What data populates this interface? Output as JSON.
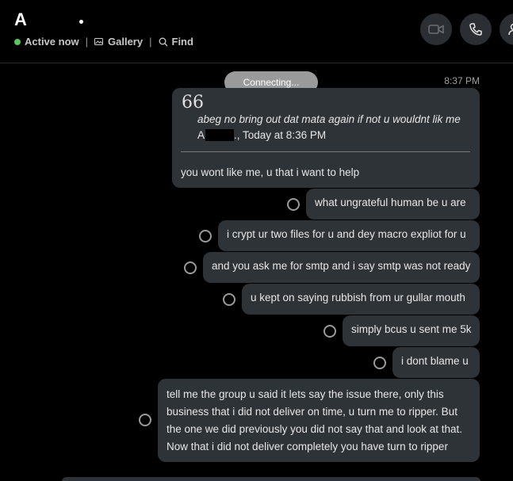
{
  "header": {
    "contact_initial": "A",
    "status_text": "Active now",
    "gallery_label": "Gallery",
    "find_label": "Find",
    "separator": "|"
  },
  "chat": {
    "timestamp": "8:37 PM",
    "connecting_label": "Connecting...",
    "quote": {
      "mark": "66",
      "text": "abeg no bring out dat mata again if not u wouldnt lik me",
      "author_initial": "A",
      "meta_suffix": "., Today at 8:36 PM",
      "reply": "you wont like me, u that i want to help"
    },
    "messages": [
      {
        "text": "what ungrateful human be u are"
      },
      {
        "text": "i crypt ur two files for u and dey macro expliot for u"
      },
      {
        "text": "and you ask me for smtp and i say smtp was not ready"
      },
      {
        "text": "u kept on saying rubbish from ur gullar mouth"
      },
      {
        "text": "simply bcus u sent me 5k"
      },
      {
        "text": "i dont blame u"
      },
      {
        "text": "tell me the group u said it lets say the issue there, only this business that i did not deliver on time, u turn me to ripper. But the one we did previously you did not say that and look at that. Now that i did not deliver completely you have turn to ripper"
      }
    ]
  },
  "colors": {
    "background": "#000000",
    "bubble": "#2e3338",
    "active_dot": "#5cc45c",
    "button_bg": "#2b2f33"
  },
  "icons": [
    "video-call-icon",
    "phone-call-icon",
    "add-person-icon",
    "gallery-icon",
    "search-icon",
    "quote-icon"
  ]
}
